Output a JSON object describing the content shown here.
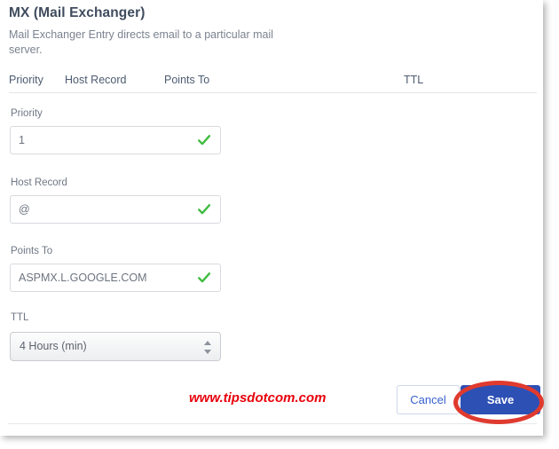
{
  "record": {
    "title": "MX (Mail Exchanger)",
    "description": "Mail Exchanger Entry directs email to a particular mail server."
  },
  "table_headers": {
    "priority": "Priority",
    "host_record": "Host Record",
    "points_to": "Points To",
    "ttl": "TTL"
  },
  "form": {
    "priority": {
      "label": "Priority",
      "value": "1",
      "valid_icon": "check-icon"
    },
    "host_record": {
      "label": "Host Record",
      "value": "@",
      "valid_icon": "check-icon"
    },
    "points_to": {
      "label": "Points To",
      "value": "ASPMX.L.GOOGLE.COM",
      "valid_icon": "check-icon"
    },
    "ttl": {
      "label": "TTL",
      "value": "4 Hours (min)",
      "stepper_icon": "updown-stepper-icon"
    }
  },
  "footer": {
    "cancel_label": "Cancel",
    "save_label": "Save",
    "watermark": "www.tipsdotcom.com"
  },
  "colors": {
    "save_button": "#2d50b5",
    "cancel_text": "#3761cf",
    "valid_check": "#3dbb3d",
    "annotation": "#e03a2f",
    "watermark": "#e8000b",
    "title_text": "#3f4c5e"
  }
}
